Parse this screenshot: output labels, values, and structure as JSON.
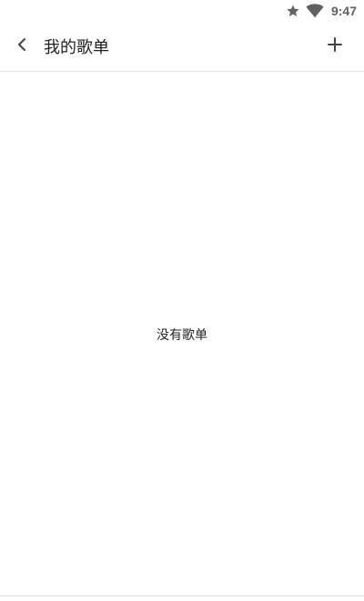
{
  "status_bar": {
    "time": "9:47",
    "icons": [
      "star-icon",
      "wifi-icon"
    ]
  },
  "toolbar": {
    "back_icon": "chevron-left-icon",
    "title": "我的歌单",
    "add_icon": "plus-icon"
  },
  "content": {
    "empty_message": "没有歌单"
  }
}
